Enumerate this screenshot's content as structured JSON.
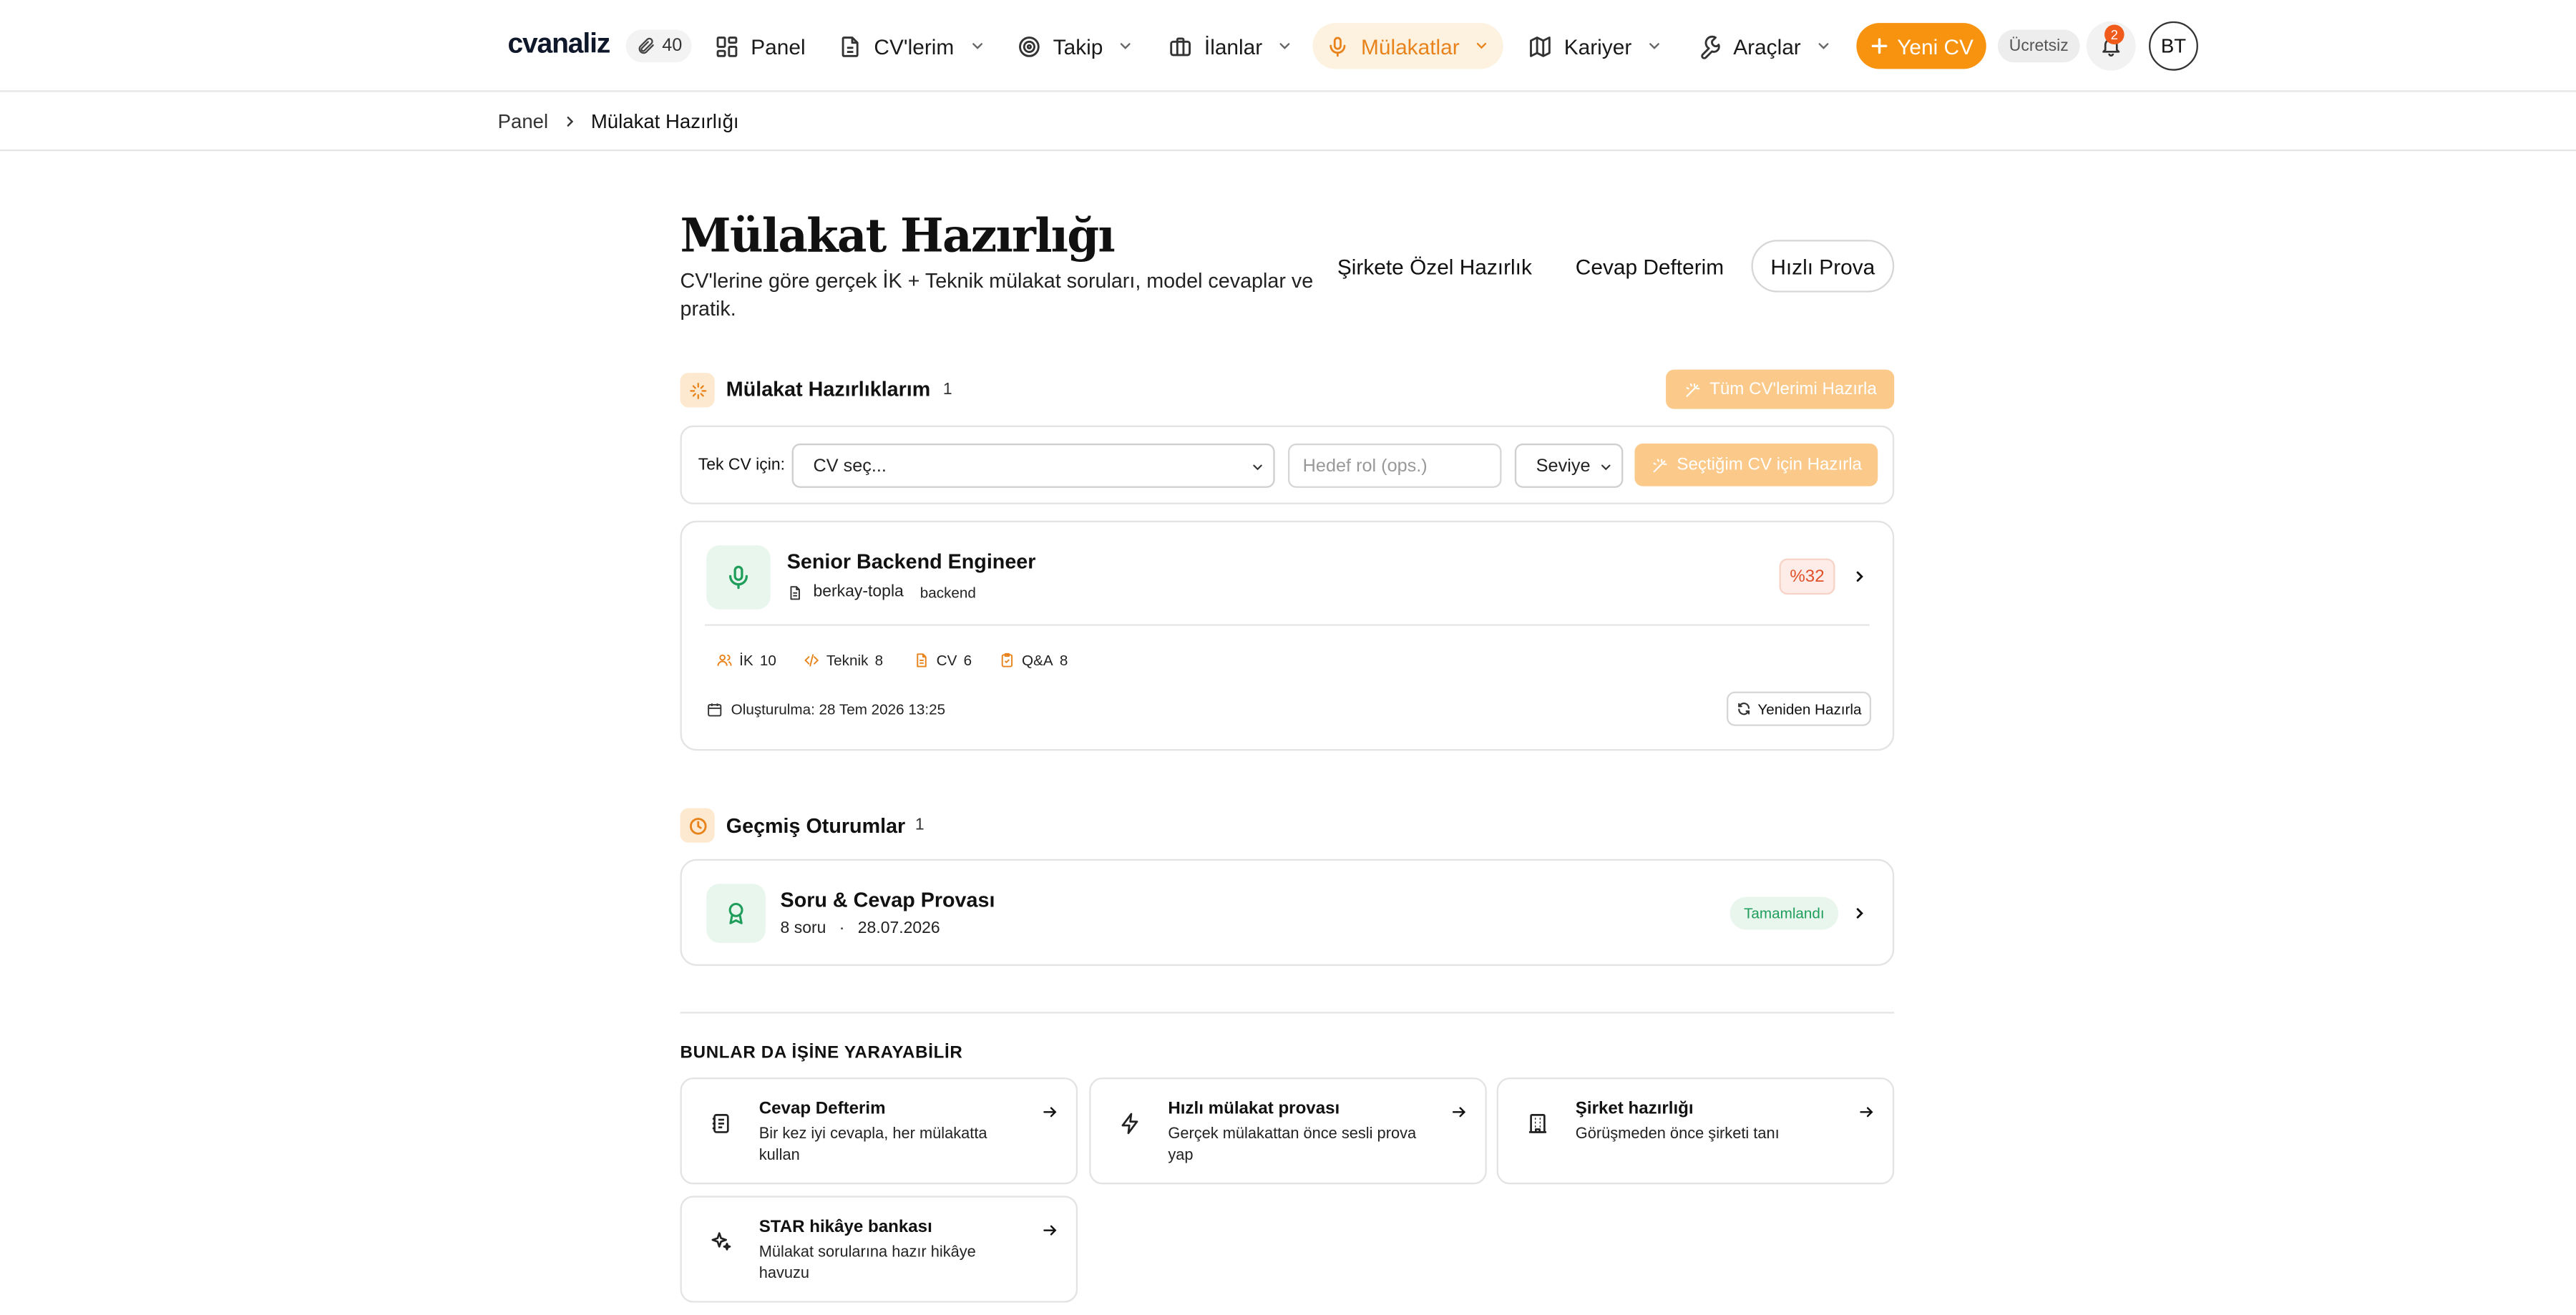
{
  "header": {
    "logo": "cvanaliz",
    "credits": "40",
    "nav": [
      {
        "label": "Panel",
        "icon": "grid-icon"
      },
      {
        "label": "CV'lerim",
        "icon": "document-icon"
      },
      {
        "label": "Takip",
        "icon": "target-icon"
      },
      {
        "label": "İlanlar",
        "icon": "briefcase-icon"
      },
      {
        "label": "Mülakatlar",
        "icon": "microphone-icon",
        "active": true
      },
      {
        "label": "Kariyer",
        "icon": "map-icon"
      },
      {
        "label": "Araçlar",
        "icon": "wrench-icon"
      }
    ],
    "new_cv": "Yeni CV",
    "plan": "Ücretsiz",
    "notifications": "2",
    "avatar": "BT"
  },
  "breadcrumb": {
    "home": "Panel",
    "current": "Mülakat Hazırlığı"
  },
  "page": {
    "title": "Mülakat Hazırlığı",
    "subtitle": "CV'lerine göre gerçek İK + Teknik mülakat soruları, model cevaplar ve pratik.",
    "links": [
      "Şirkete Özel Hazırlık",
      "Cevap Defterim"
    ],
    "quick_practice": "Hızlı Prova"
  },
  "preparations": {
    "title": "Mülakat Hazırlıklarım",
    "count": "1",
    "prepare_all": "Tüm CV'lerimi Hazırla",
    "single_label": "Tek CV için:",
    "cv_select": "CV seç...",
    "role_placeholder": "Hedef rol (ops.)",
    "level_select": "Seviye",
    "prepare_one": "Seçtiğim CV için Hazırla",
    "card": {
      "title": "Senior Backend Engineer",
      "cv_name": "berkay-topla",
      "tag": "backend",
      "score": "%32",
      "stats": [
        {
          "label": "İK",
          "count": "10",
          "icon": "users-icon"
        },
        {
          "label": "Teknik",
          "count": "8",
          "icon": "code-icon"
        },
        {
          "label": "CV",
          "count": "6",
          "icon": "file-icon"
        },
        {
          "label": "Q&A",
          "count": "8",
          "icon": "clipboard-icon"
        }
      ],
      "created": "Oluşturulma: 28 Tem 2026 13:25",
      "rebuild": "Yeniden Hazırla"
    }
  },
  "sessions": {
    "title": "Geçmiş Oturumlar",
    "count": "1",
    "item": {
      "title": "Soru & Cevap Provası",
      "questions": "8 soru",
      "separator": "·",
      "date": "28.07.2026",
      "status": "Tamamlandı"
    }
  },
  "suggestions": {
    "heading": "BUNLAR DA İŞİNE YARAYABİLİR",
    "items": [
      {
        "title": "Cevap Defterim",
        "desc": "Bir kez iyi cevapla, her mülakatta kullan",
        "icon": "notebook-icon"
      },
      {
        "title": "Hızlı mülakat provası",
        "desc": "Gerçek mülakattan önce sesli prova yap",
        "icon": "lightning-icon"
      },
      {
        "title": "Şirket hazırlığı",
        "desc": "Görüşmeden önce şirketi tanı",
        "icon": "building-icon"
      },
      {
        "title": "STAR hikâye bankası",
        "desc": "Mülakat sorularına hazır hikâye havuzu",
        "icon": "sparkles-icon"
      }
    ]
  },
  "colors": {
    "accent": "#f7930e",
    "accent_soft": "#fde9cf",
    "success": "#1f9d5a",
    "danger": "#e0502a"
  }
}
